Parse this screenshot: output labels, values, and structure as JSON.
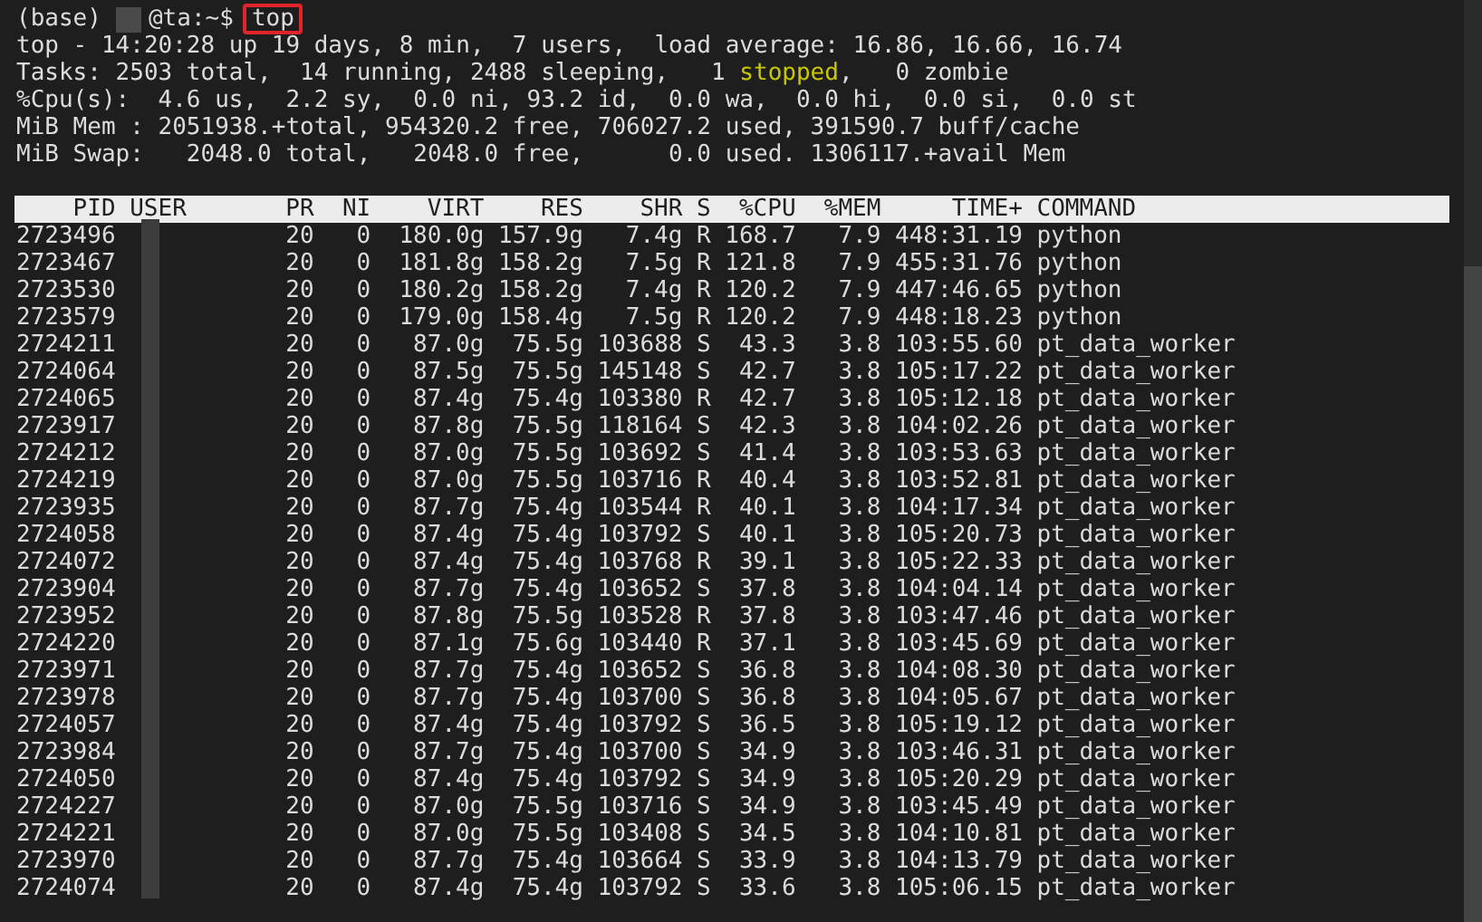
{
  "prompt": {
    "env": "(base)",
    "host": "@ta:~$",
    "command": "top",
    "highlighted": true
  },
  "summary": [
    [
      {
        "text": "top - 14:20:28 up 19 days, 8 min,  7 users,  load average: 16.86, 16.66, 16.74",
        "kind": "normal"
      }
    ],
    [
      {
        "text": "Tasks: 2503 total,  14 running, 2488 sleeping,   1 ",
        "kind": "normal"
      },
      {
        "text": "stopped",
        "kind": "highlight"
      },
      {
        "text": ",   0 zombie",
        "kind": "normal"
      }
    ],
    [
      {
        "text": "%Cpu(s):  4.6 us,  2.2 sy,  0.0 ni, 93.2 id,  0.0 wa,  0.0 hi,  0.0 si,  0.0 st",
        "kind": "normal"
      }
    ],
    [
      {
        "text": "MiB Mem : 2051938.+total, 954320.2 free, 706027.2 used, 391590.7 buff/cache",
        "kind": "normal"
      }
    ],
    [
      {
        "text": "MiB Swap:   2048.0 total,   2048.0 free,      0.0 used. 1306117.+avail Mem",
        "kind": "normal"
      }
    ]
  ],
  "table": {
    "columns": [
      "PID",
      "USER",
      "PR",
      "NI",
      "VIRT",
      "RES",
      "SHR",
      "S",
      "%CPU",
      "%MEM",
      "TIME+",
      "COMMAND"
    ],
    "rows": [
      [
        "2723496",
        "",
        "20",
        "0",
        "180.0g",
        "157.9g",
        "7.4g",
        "R",
        "168.7",
        "7.9",
        "448:31.19",
        "python"
      ],
      [
        "2723467",
        "",
        "20",
        "0",
        "181.8g",
        "158.2g",
        "7.5g",
        "R",
        "121.8",
        "7.9",
        "455:31.76",
        "python"
      ],
      [
        "2723530",
        "",
        "20",
        "0",
        "180.2g",
        "158.2g",
        "7.4g",
        "R",
        "120.2",
        "7.9",
        "447:46.65",
        "python"
      ],
      [
        "2723579",
        "",
        "20",
        "0",
        "179.0g",
        "158.4g",
        "7.5g",
        "R",
        "120.2",
        "7.9",
        "448:18.23",
        "python"
      ],
      [
        "2724211",
        "",
        "20",
        "0",
        "87.0g",
        "75.5g",
        "103688",
        "S",
        "43.3",
        "3.8",
        "103:55.60",
        "pt_data_worker"
      ],
      [
        "2724064",
        "",
        "20",
        "0",
        "87.5g",
        "75.5g",
        "145148",
        "S",
        "42.7",
        "3.8",
        "105:17.22",
        "pt_data_worker"
      ],
      [
        "2724065",
        "",
        "20",
        "0",
        "87.4g",
        "75.4g",
        "103380",
        "R",
        "42.7",
        "3.8",
        "105:12.18",
        "pt_data_worker"
      ],
      [
        "2723917",
        "",
        "20",
        "0",
        "87.8g",
        "75.5g",
        "118164",
        "S",
        "42.3",
        "3.8",
        "104:02.26",
        "pt_data_worker"
      ],
      [
        "2724212",
        "",
        "20",
        "0",
        "87.0g",
        "75.5g",
        "103692",
        "S",
        "41.4",
        "3.8",
        "103:53.63",
        "pt_data_worker"
      ],
      [
        "2724219",
        "",
        "20",
        "0",
        "87.0g",
        "75.5g",
        "103716",
        "R",
        "40.4",
        "3.8",
        "103:52.81",
        "pt_data_worker"
      ],
      [
        "2723935",
        "",
        "20",
        "0",
        "87.7g",
        "75.4g",
        "103544",
        "R",
        "40.1",
        "3.8",
        "104:17.34",
        "pt_data_worker"
      ],
      [
        "2724058",
        "",
        "20",
        "0",
        "87.4g",
        "75.4g",
        "103792",
        "S",
        "40.1",
        "3.8",
        "105:20.73",
        "pt_data_worker"
      ],
      [
        "2724072",
        "",
        "20",
        "0",
        "87.4g",
        "75.4g",
        "103768",
        "R",
        "39.1",
        "3.8",
        "105:22.33",
        "pt_data_worker"
      ],
      [
        "2723904",
        "",
        "20",
        "0",
        "87.7g",
        "75.4g",
        "103652",
        "S",
        "37.8",
        "3.8",
        "104:04.14",
        "pt_data_worker"
      ],
      [
        "2723952",
        "",
        "20",
        "0",
        "87.8g",
        "75.5g",
        "103528",
        "R",
        "37.8",
        "3.8",
        "103:47.46",
        "pt_data_worker"
      ],
      [
        "2724220",
        "",
        "20",
        "0",
        "87.1g",
        "75.6g",
        "103440",
        "R",
        "37.1",
        "3.8",
        "103:45.69",
        "pt_data_worker"
      ],
      [
        "2723971",
        "",
        "20",
        "0",
        "87.7g",
        "75.4g",
        "103652",
        "S",
        "36.8",
        "3.8",
        "104:08.30",
        "pt_data_worker"
      ],
      [
        "2723978",
        "",
        "20",
        "0",
        "87.7g",
        "75.4g",
        "103700",
        "S",
        "36.8",
        "3.8",
        "104:05.67",
        "pt_data_worker"
      ],
      [
        "2724057",
        "",
        "20",
        "0",
        "87.4g",
        "75.4g",
        "103792",
        "S",
        "36.5",
        "3.8",
        "105:19.12",
        "pt_data_worker"
      ],
      [
        "2723984",
        "",
        "20",
        "0",
        "87.7g",
        "75.4g",
        "103700",
        "S",
        "34.9",
        "3.8",
        "103:46.31",
        "pt_data_worker"
      ],
      [
        "2724050",
        "",
        "20",
        "0",
        "87.4g",
        "75.4g",
        "103792",
        "S",
        "34.9",
        "3.8",
        "105:20.29",
        "pt_data_worker"
      ],
      [
        "2724227",
        "",
        "20",
        "0",
        "87.0g",
        "75.5g",
        "103716",
        "S",
        "34.9",
        "3.8",
        "103:45.49",
        "pt_data_worker"
      ],
      [
        "2724221",
        "",
        "20",
        "0",
        "87.0g",
        "75.5g",
        "103408",
        "S",
        "34.5",
        "3.8",
        "104:10.81",
        "pt_data_worker"
      ],
      [
        "2723970",
        "",
        "20",
        "0",
        "87.7g",
        "75.4g",
        "103664",
        "S",
        "33.9",
        "3.8",
        "104:13.79",
        "pt_data_worker"
      ],
      [
        "2724074",
        "",
        "20",
        "0",
        "87.4g",
        "75.4g",
        "103792",
        "S",
        "33.6",
        "3.8",
        "105:06.15",
        "pt_data_worker"
      ]
    ]
  }
}
